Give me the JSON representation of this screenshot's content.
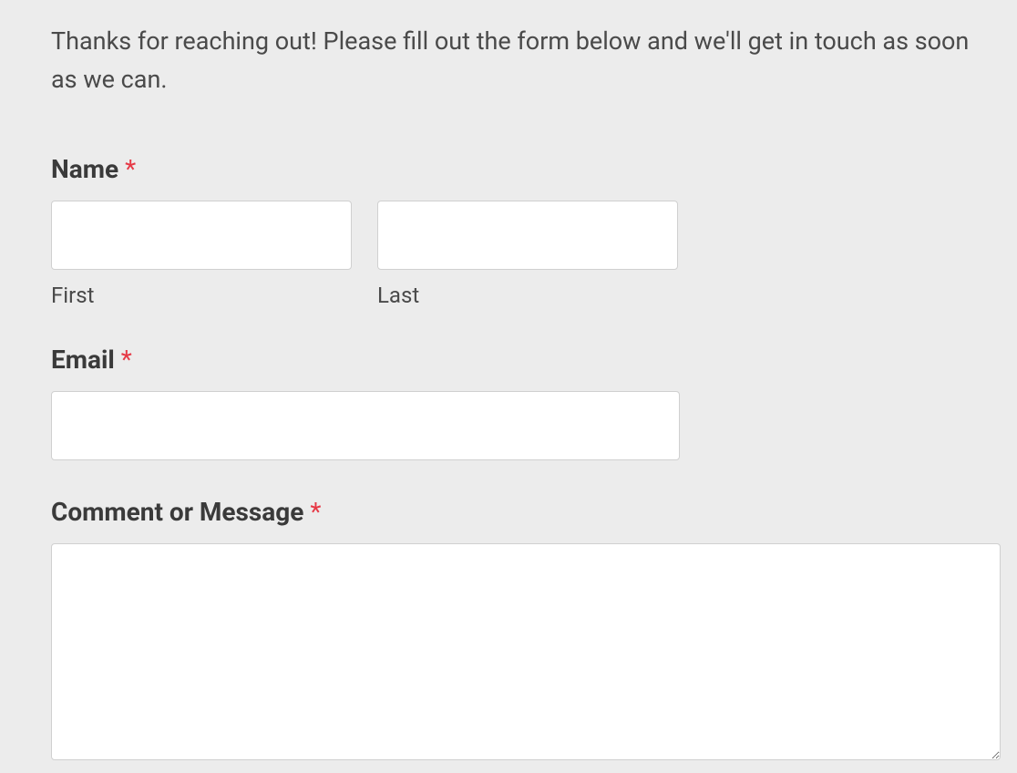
{
  "intro": "Thanks for reaching out! Please fill out the form below and we'll get in touch as soon as we can.",
  "form": {
    "name": {
      "label": "Name ",
      "required_marker": "*",
      "first_sublabel": "First",
      "last_sublabel": "Last",
      "first_value": "",
      "last_value": ""
    },
    "email": {
      "label": "Email ",
      "required_marker": "*",
      "value": ""
    },
    "message": {
      "label": "Comment or Message ",
      "required_marker": "*",
      "value": ""
    }
  }
}
